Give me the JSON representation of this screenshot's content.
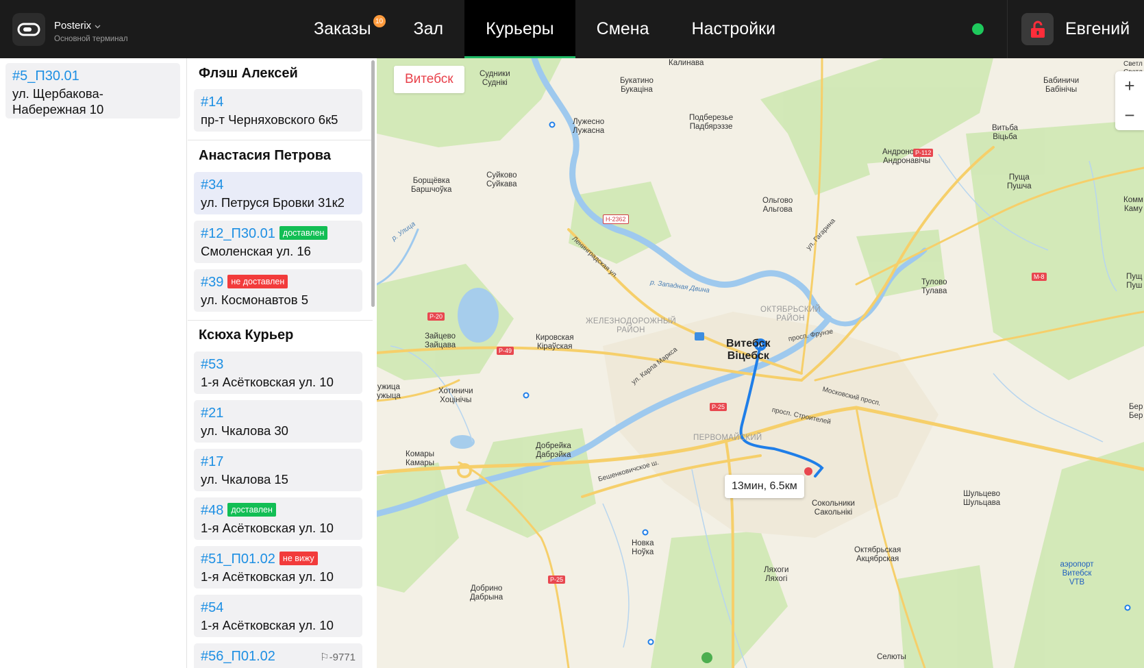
{
  "brand": {
    "name": "Posterix",
    "subtitle": "Основной терминал"
  },
  "nav": {
    "tabs": [
      {
        "label": "Заказы",
        "badge": "10"
      },
      {
        "label": "Зал"
      },
      {
        "label": "Курьеры",
        "active": true
      },
      {
        "label": "Смена"
      },
      {
        "label": "Настройки"
      }
    ]
  },
  "status": {
    "color": "#1ec95c"
  },
  "user": {
    "name": "Евгений",
    "icon": "lock-open-icon"
  },
  "unassigned": [
    {
      "number": "#5_П30.01",
      "address": "ул. Щербакова-Набережная 10"
    }
  ],
  "couriers": [
    {
      "name": "Флэш Алексей",
      "orders": [
        {
          "number": "#14",
          "address": "пр-т Черняховского 6к5"
        }
      ]
    },
    {
      "name": "Анастасия Петрова",
      "orders": [
        {
          "number": "#34",
          "address": "ул. Петруся Бровки 31к2",
          "selected": true
        },
        {
          "number": "#12_П30.01",
          "address": "Смоленская ул. 16",
          "status": "доставлен"
        },
        {
          "number": "#39",
          "address": "ул. Космонавтов 5",
          "status": "не доставлен"
        }
      ]
    },
    {
      "name": "Ксюха Курьер",
      "orders": [
        {
          "number": "#53",
          "address": "1-я Асётковская ул. 10"
        },
        {
          "number": "#21",
          "address": "ул. Чкалова 30"
        },
        {
          "number": "#17",
          "address": "ул. Чкалова 15"
        },
        {
          "number": "#48",
          "address": "1-я Асётковская ул. 10",
          "status": "доставлен"
        },
        {
          "number": "#51_П01.02",
          "address": "1-я Асётковская ул. 10",
          "status": "не вижу"
        },
        {
          "number": "#54",
          "address": "1-я Асётковская ул. 10"
        },
        {
          "number": "#56_П01.02",
          "address": "",
          "phone": "-9771"
        }
      ]
    }
  ],
  "map": {
    "city_chip": "Витебск",
    "zoom_in": "+",
    "zoom_out": "−",
    "route_info": "13мин, 6.5км",
    "route_start_marker": "A",
    "city_label": "Витебск",
    "city_label_by": "Віцебск",
    "places": [
      {
        "name": "Калинава"
      },
      {
        "name": "Судники",
        "alt": "Суднікі"
      },
      {
        "name": "Букатино",
        "alt": "Букаціна"
      },
      {
        "name": "Лужесно",
        "alt": "Лужасна"
      },
      {
        "name": "Подберезье",
        "alt": "Падбярэззе"
      },
      {
        "name": "Бабиничи",
        "alt": "Бабінічы"
      },
      {
        "name": "Витьба",
        "alt": "Віцьба"
      },
      {
        "name": "Андроновичи",
        "alt": "Андронавічы"
      },
      {
        "name": "Суйково",
        "alt": "Суйкава"
      },
      {
        "name": "Борщёвка",
        "alt": "Баршчоўка"
      },
      {
        "name": "Пуща",
        "alt": "Пушча"
      },
      {
        "name": "Ольгово",
        "alt": "Альгова"
      },
      {
        "name": "Тулово",
        "alt": "Тулава"
      },
      {
        "name": "Зайцево",
        "alt": "Зайцава"
      },
      {
        "name": "Кировская",
        "alt": "Кіраўская"
      },
      {
        "name": "Хотиничи",
        "alt": "Хоцінічы"
      },
      {
        "name": "Добрейка",
        "alt": "Дабрэйка"
      },
      {
        "name": "Комары",
        "alt": "Камары"
      },
      {
        "name": "Сокольники",
        "alt": "Сакольнікі"
      },
      {
        "name": "Шульцево",
        "alt": "Шульцава"
      },
      {
        "name": "Новка",
        "alt": "Ноўка"
      },
      {
        "name": "Октябрьская",
        "alt": "Акцябрская"
      },
      {
        "name": "Ляхоги",
        "alt": "Ляхогі"
      },
      {
        "name": "Добрино",
        "alt": "Дабрына"
      },
      {
        "name": "Селюты"
      },
      {
        "name": "аэропорт Витебск VTB"
      },
      {
        "name": "Светл",
        "alt": "Светл"
      },
      {
        "name": "Комм",
        "alt": "Каму"
      },
      {
        "name": "Пущ",
        "alt": "Пуш"
      },
      {
        "name": "Бер",
        "alt": "Бер"
      },
      {
        "name": "ужица",
        "alt": "ужыца"
      }
    ],
    "districts": [
      {
        "name": "ОКТЯБРЬСКИЙ",
        "alt": "РАЙОН"
      },
      {
        "name": "ЖЕЛЕЗНОДОРОЖНЫЙ",
        "alt": "РАЙОН"
      },
      {
        "name": "ПЕРВОМАЙСКИЙ"
      }
    ],
    "roads": [
      "Ленинградская ул.",
      "р. Западная Двина",
      "ул. Гагарина",
      "просп. Фрунзе",
      "Московский просп.",
      "просп. Строителей",
      "ул. Карла Маркса",
      "Бешенковичское ш.",
      "р. Улица"
    ],
    "shields": [
      "Р-112",
      "Н-2362",
      "Р-20",
      "Р-49",
      "Р-25",
      "М-8",
      "Р-25"
    ]
  }
}
